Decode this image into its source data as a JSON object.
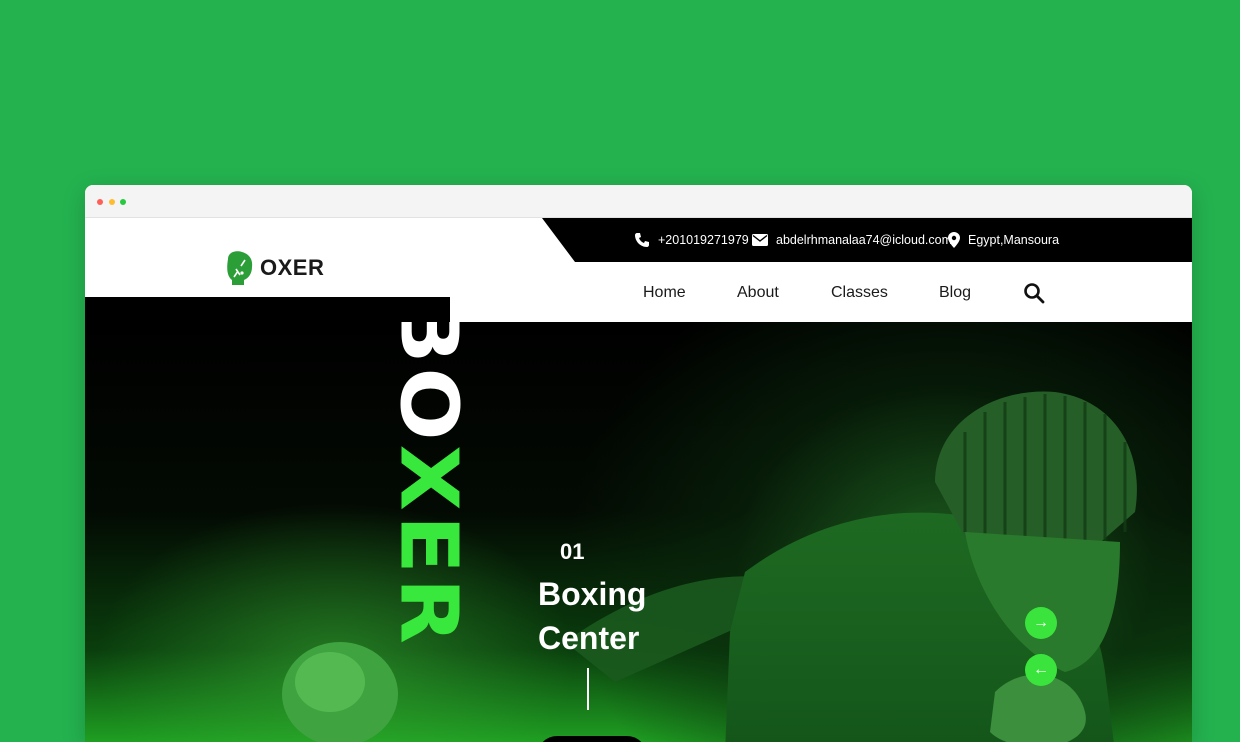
{
  "brand": {
    "name": "OXER",
    "logo_icon": "boxing-glove-icon",
    "accent": "#3be43d",
    "background": "#24b24f"
  },
  "contact": {
    "phone": "+201019271979",
    "email": "abdelrhmanalaa74@icloud.com",
    "location": "Egypt,Mansoura",
    "icons": [
      "phone-icon",
      "mail-icon",
      "location-pin-icon"
    ]
  },
  "nav": {
    "items": [
      "Home",
      "About",
      "Classes",
      "Blog"
    ],
    "search_icon": "search-icon"
  },
  "hero": {
    "vertical_word_white": "BO",
    "vertical_word_green": "XER",
    "slide_number": "01",
    "slide_title_line1": "Boxing",
    "slide_title_line2": "Center",
    "arrow_next_symbol": "→",
    "arrow_prev_symbol": "←"
  }
}
